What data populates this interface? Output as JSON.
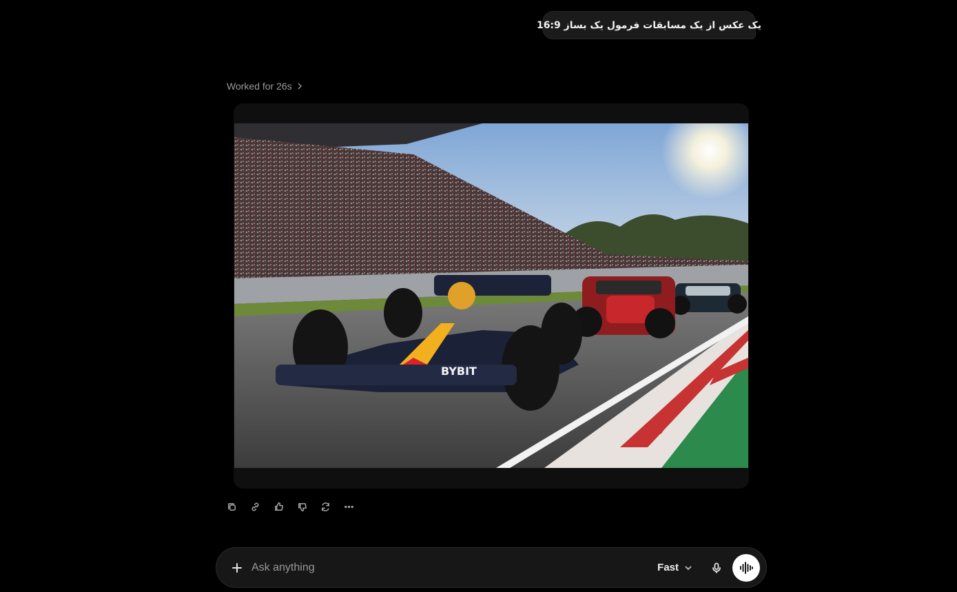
{
  "conversation": {
    "user_message": "یک عکس از یک مسابقات فرمول یک بساز 16:9",
    "worked_for": "Worked for 26s"
  },
  "image": {
    "car_livery": "BYBIT"
  },
  "actions": [
    {
      "name": "copy-icon"
    },
    {
      "name": "link-icon"
    },
    {
      "name": "thumbs-up-icon"
    },
    {
      "name": "thumbs-down-icon"
    },
    {
      "name": "regenerate-icon"
    },
    {
      "name": "more-icon"
    }
  ],
  "composer": {
    "placeholder": "Ask anything",
    "model": "Fast"
  },
  "colors": {
    "background": "#000000",
    "bubble": "#1b1b1b",
    "composer": "#171717",
    "muted_text": "#9b9b9b"
  }
}
